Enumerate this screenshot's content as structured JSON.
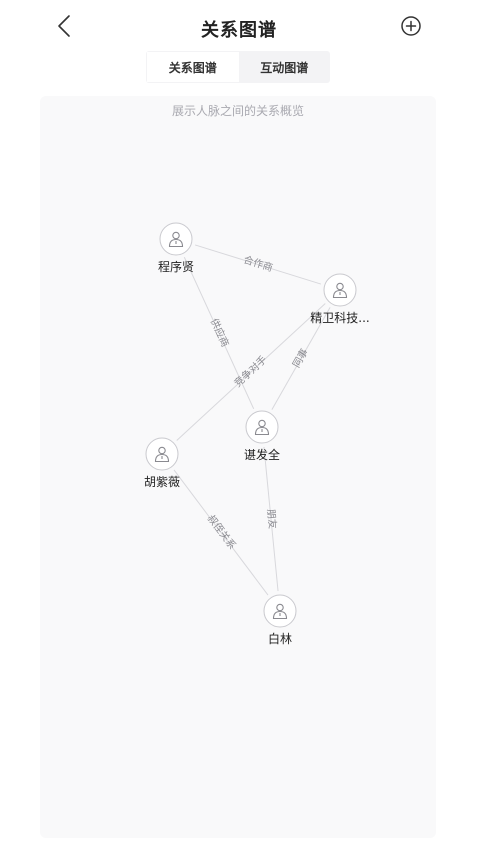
{
  "header": {
    "title": "关系图谱",
    "back_icon": "chevron-left-icon",
    "add_icon": "plus-circle-icon"
  },
  "tabs": [
    {
      "label": "关系图谱",
      "active": true
    },
    {
      "label": "互动图谱",
      "active": false
    }
  ],
  "graph": {
    "subtitle": "展示人脉之间的关系概览",
    "node_icon": "person-icon",
    "nodes": [
      {
        "id": "chengxuxian",
        "name": "程序贤"
      },
      {
        "id": "jingwei",
        "name": "精卫科技..."
      },
      {
        "id": "huziwei",
        "name": "胡紫薇"
      },
      {
        "id": "chenfaquan",
        "name": "谌发全"
      },
      {
        "id": "bailin",
        "name": "白林"
      }
    ],
    "edges": [
      {
        "from": "chengxuxian",
        "to": "jingwei",
        "label": "合作商"
      },
      {
        "from": "chengxuxian",
        "to": "chenfaquan",
        "label": "供应商"
      },
      {
        "from": "jingwei",
        "to": "huziwei",
        "label": "竞争对手"
      },
      {
        "from": "jingwei",
        "to": "chenfaquan",
        "label": "同事"
      },
      {
        "from": "chenfaquan",
        "to": "bailin",
        "label": "朋友"
      },
      {
        "from": "huziwei",
        "to": "bailin",
        "label": "叔侄关系"
      }
    ]
  }
}
